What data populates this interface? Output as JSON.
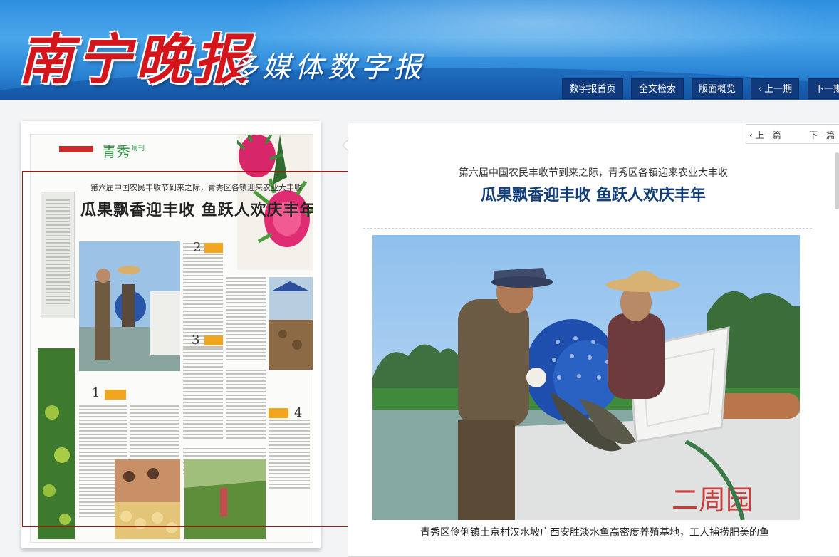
{
  "header": {
    "logo_text": "南宁晚报",
    "subtitle": "多媒体数字报",
    "nav": [
      {
        "label": "数字报首页"
      },
      {
        "label": "全文检索"
      },
      {
        "label": "版面概览"
      },
      {
        "label": "上一期"
      },
      {
        "label": "下一期"
      }
    ]
  },
  "thumbnail": {
    "masthead": "青秀",
    "masthead_suffix": "周刊",
    "kicker": "第六届中国农民丰收节到来之际，青秀区各镇迎来农业大丰收",
    "headline": "瓜果飘香迎丰收 鱼跃人欢庆丰年",
    "section_numbers": [
      "1",
      "2",
      "3",
      "4"
    ]
  },
  "article": {
    "pager": {
      "prev": "上一篇",
      "next": "下一篇"
    },
    "kicker": "第六届中国农民丰收节到来之际，青秀区各镇迎来农业大丰收",
    "title": "瓜果飘香迎丰收 鱼跃人欢庆丰年",
    "caption": "青秀区伶俐镇土京村汉水坡广西安胜淡水鱼高密度养殖基地，工人捕捞肥美的鱼"
  },
  "colors": {
    "header_blue": "#2c86d6",
    "nav_button": "#103a7c",
    "logo_red": "#d4161c",
    "title_blue": "#123f7a",
    "highlight_frame": "#d40000"
  }
}
